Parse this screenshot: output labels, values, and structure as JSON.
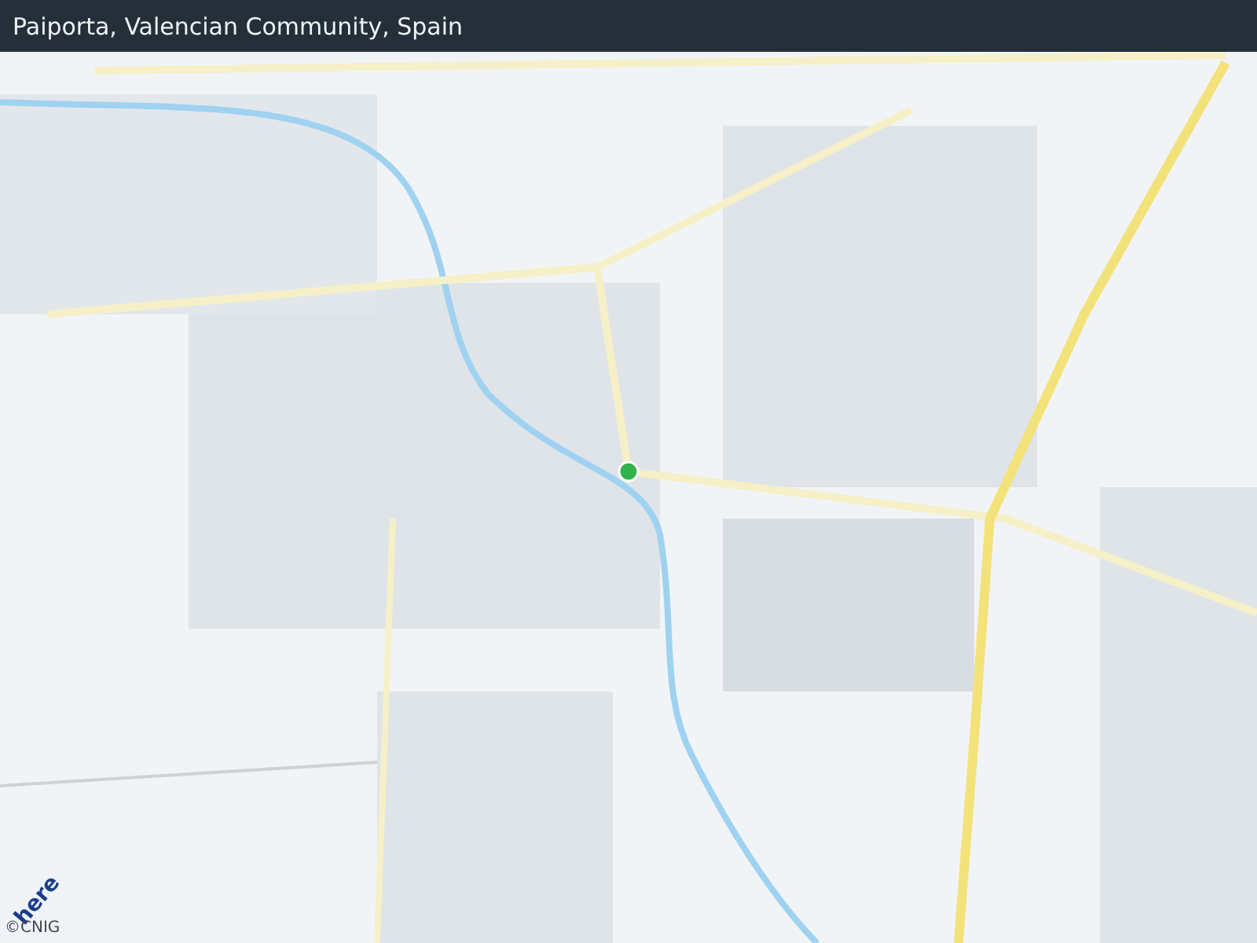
{
  "header": {
    "title": "Paiporta, Valencian Community, Spain"
  },
  "map": {
    "logo": "here",
    "attribution": "©CNIG"
  }
}
